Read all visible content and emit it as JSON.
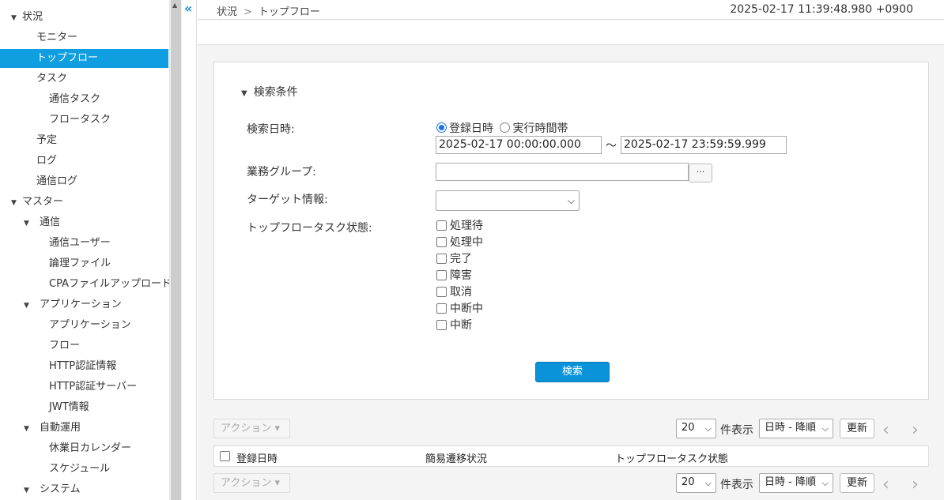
{
  "sidebar": {
    "items": [
      {
        "label": "状況",
        "tri": "▼"
      },
      {
        "label": "モニター"
      },
      {
        "label": "トップフロー"
      },
      {
        "label": "タスク"
      },
      {
        "label": "通信タスク"
      },
      {
        "label": "フロータスク"
      },
      {
        "label": "予定"
      },
      {
        "label": "ログ"
      },
      {
        "label": "通信ログ"
      },
      {
        "label": "マスター",
        "tri": "▼"
      },
      {
        "label": "通信",
        "tri": "▼"
      },
      {
        "label": "通信ユーザー"
      },
      {
        "label": "論理ファイル"
      },
      {
        "label": "CPAファイルアップロード"
      },
      {
        "label": "アプリケーション",
        "tri": "▼"
      },
      {
        "label": "アプリケーション"
      },
      {
        "label": "フロー"
      },
      {
        "label": "HTTP認証情報"
      },
      {
        "label": "HTTP認証サーバー"
      },
      {
        "label": "JWT情報"
      },
      {
        "label": "自動運用",
        "tri": "▼"
      },
      {
        "label": "休業日カレンダー"
      },
      {
        "label": "スケジュール"
      },
      {
        "label": "システム",
        "tri": "▼"
      }
    ],
    "collapse_glyph": "«",
    "scroll_up_glyph": "▲"
  },
  "header": {
    "breadcrumb_root": "状況",
    "breadcrumb_sep": ">",
    "breadcrumb_current": "トップフロー",
    "timestamp": "2025-02-17 11:39:48.980 +0900"
  },
  "search": {
    "section_arrow": "▼",
    "section_title": "検索条件",
    "date_label": "検索日時:",
    "radio_registered": "登録日時",
    "radio_exec": "実行時間帯",
    "date_from": "2025-02-17 00:00:00.000",
    "tilde": "～",
    "date_to": "2025-02-17 23:59:59.999",
    "group_label": "業務グループ:",
    "group_value": "",
    "ellipsis": "···",
    "target_label": "ターゲット情報:",
    "target_value": "",
    "status_label": "トップフロータスク状態:",
    "statuses": [
      "処理待",
      "処理中",
      "完了",
      "障害",
      "取消",
      "中断中",
      "中断"
    ],
    "search_button": "検索"
  },
  "list": {
    "action": "アクション",
    "caret": "▾",
    "per_page": "20",
    "per_page_label": "件表示",
    "sort": "日時 - 降順",
    "update": "更新",
    "prev": "‹",
    "next": "›",
    "columns": [
      "登録日時",
      "簡易遷移状況",
      "トップフロータスク状態"
    ]
  },
  "colors": {
    "accent": "#0f9ee0",
    "button": "#0b93d9"
  }
}
